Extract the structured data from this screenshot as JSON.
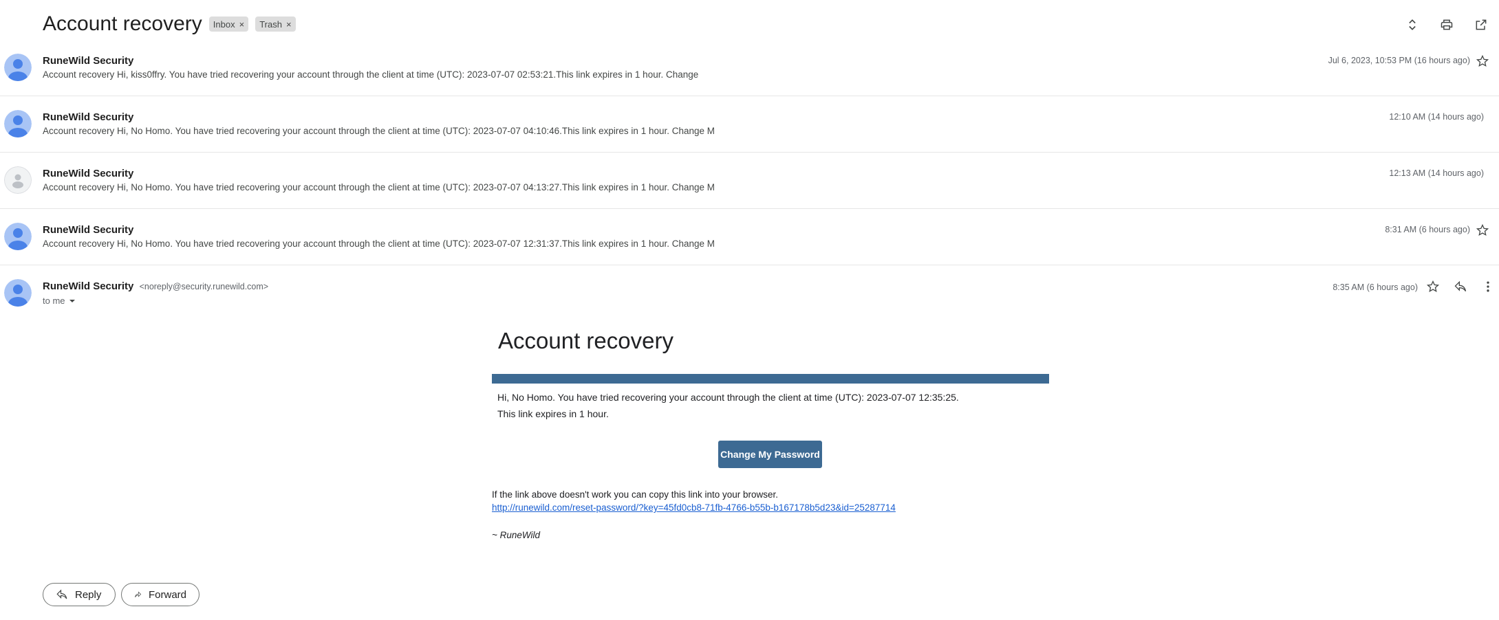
{
  "header": {
    "subject": "Account recovery",
    "labels": [
      {
        "name": "Inbox",
        "remove": "×"
      },
      {
        "name": "Trash",
        "remove": "×"
      }
    ],
    "actions": [
      "expand-all-icon",
      "print-icon",
      "open-in-new-window-icon"
    ]
  },
  "thread": [
    {
      "sender": "RuneWild Security",
      "snippet": "Account recovery Hi, kiss0ffry. You have tried recovering your account through the client at time (UTC): 2023-07-07 02:53:21.This link expires in 1 hour. Change",
      "time": "Jul 6, 2023, 10:53 PM (16 hours ago)",
      "starred": false
    },
    {
      "sender": "RuneWild Security",
      "snippet": "Account recovery Hi, No Homo. You have tried recovering your account through the client at time (UTC): 2023-07-07 04:10:46.This link expires in 1 hour. Change M",
      "time": "12:10 AM (14 hours ago)"
    },
    {
      "sender": "RuneWild Security",
      "snippet": "Account recovery Hi, No Homo. You have tried recovering your account through the client at time (UTC): 2023-07-07 04:13:27.This link expires in 1 hour. Change M",
      "time": "12:13 AM (14 hours ago)"
    },
    {
      "sender": "RuneWild Security",
      "snippet": "Account recovery Hi, No Homo. You have tried recovering your account through the client at time (UTC): 2023-07-07 12:31:37.This link expires in 1 hour. Change M",
      "time": "8:31 AM (6 hours ago)",
      "starred": false
    }
  ],
  "open_email": {
    "sender": "RuneWild Security",
    "from_address": "<noreply@security.runewild.com>",
    "to": "to me",
    "time": "8:35 AM (6 hours ago)",
    "body": {
      "title": "Account recovery",
      "line1": "Hi, No Homo. You have tried recovering your account through the client at time (UTC): 2023-07-07 12:35:25.",
      "line2": "This link expires in 1 hour.",
      "button": "Change My Password",
      "copy_note": "If the link above doesn't work you can copy this link into your browser.",
      "link": "http://runewild.com/reset-password/?key=45fd0cb8-71fb-4766-b55b-b167178b5d23&id=25287714",
      "signature": "~ RuneWild"
    }
  },
  "footer": {
    "reply": "Reply",
    "forward": "Forward"
  },
  "colors": {
    "brand_bar": "#3d6a93",
    "avatar_bg": "#a8c4f5",
    "avatar_fg": "#4a82e8",
    "link": "#1a5fd1"
  }
}
